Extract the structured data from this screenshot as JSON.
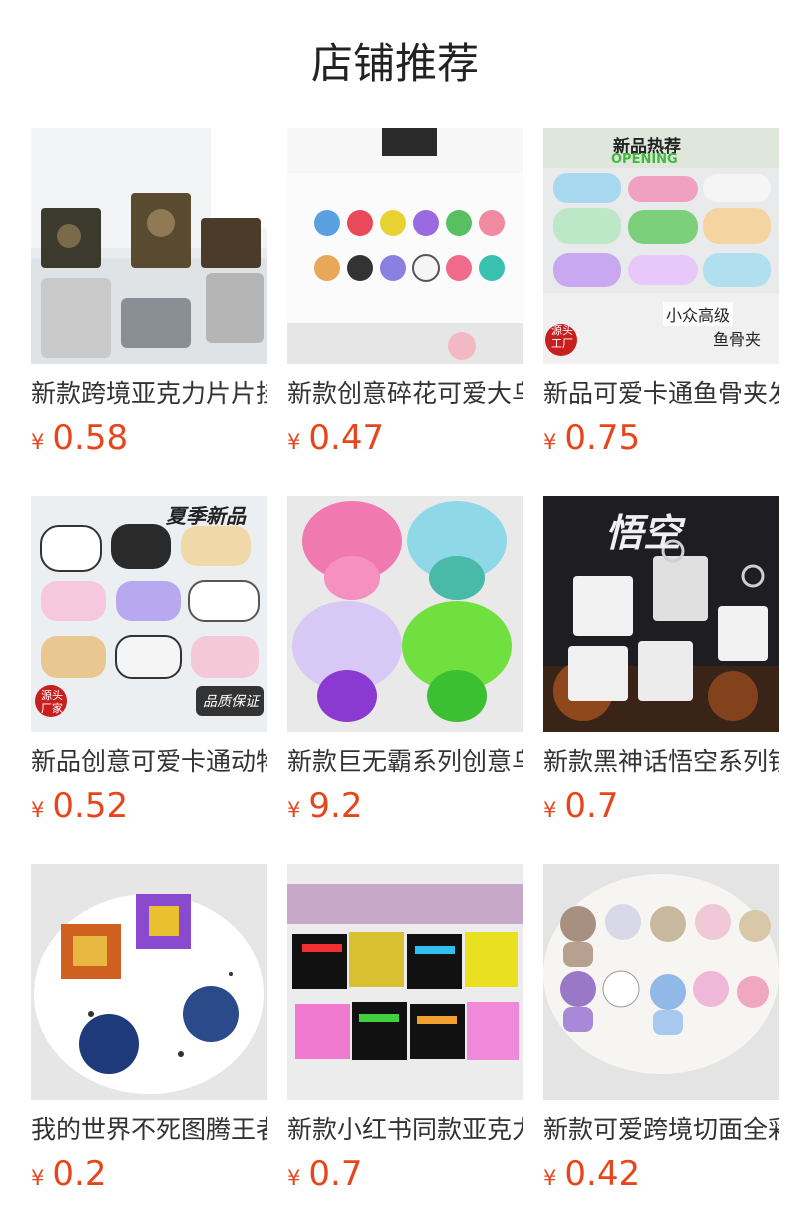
{
  "header": {
    "title": "店铺推荐"
  },
  "currency_symbol": "¥",
  "products": [
    {
      "name": "新款跨境亚克力片片挂件",
      "price": "0.58",
      "badge_lines": []
    },
    {
      "name": "新款创意碎花可爱大乌龟",
      "price": "0.47",
      "badge_lines": []
    },
    {
      "name": "新品可爱卡通鱼骨夹发",
      "price": "0.75",
      "badge_lines": [
        "新品热荐",
        "OPENING",
        "小众高级",
        "鱼骨夹",
        "源头",
        "工厂"
      ]
    },
    {
      "name": "新品创意可爱卡通动物",
      "price": "0.52",
      "badge_lines": [
        "夏季新品",
        "源头",
        "厂家",
        "品质保证"
      ]
    },
    {
      "name": "新款巨无霸系列创意乌龟",
      "price": "9.2",
      "badge_lines": []
    },
    {
      "name": "新款黑神话悟空系列钥匙",
      "price": "0.7",
      "badge_lines": [
        "悟空"
      ]
    },
    {
      "name": "我的世界不死图腾王者",
      "price": "0.2",
      "badge_lines": []
    },
    {
      "name": "新款小红书同款亚克力",
      "price": "0.7",
      "badge_lines": []
    },
    {
      "name": "新款可爱跨境切面全彩",
      "price": "0.42",
      "badge_lines": []
    }
  ],
  "colors": {
    "price": "#e5461b",
    "title": "#222222",
    "name": "#333333"
  }
}
